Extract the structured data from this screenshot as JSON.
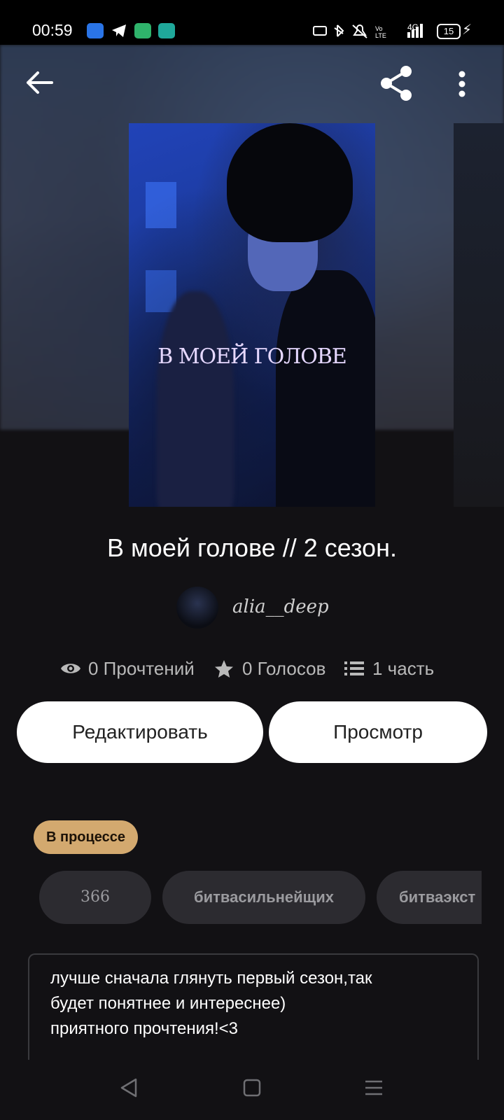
{
  "status_bar": {
    "time": "00:59",
    "network_label": "4G",
    "battery": "15"
  },
  "story": {
    "cover_title": "В МОЕЙ ГОЛОВЕ",
    "title": "В моей голове // 2 сезон.",
    "author": "alia__deep",
    "stats": {
      "reads": "0 Прочтений",
      "votes": "0 Голосов",
      "parts": "1 часть"
    },
    "status_badge": "В процессе",
    "tags": [
      "366",
      "битвасильнейщих",
      "битваэкст"
    ],
    "description": "лучше сначала глянуть первый сезон,так\nбудет понятнее и интереснее)\nприятного прочтения!<3"
  },
  "actions": {
    "edit_label": "Редактировать",
    "view_label": "Просмотр"
  },
  "colors": {
    "background": "#121114",
    "badge": "#d3a96f",
    "tag_bg": "#2c2b30",
    "button_bg": "#ffffff"
  },
  "icons": [
    "back-arrow-icon",
    "share-icon",
    "more-vertical-icon",
    "eye-icon",
    "star-icon",
    "list-icon",
    "nav-back-icon",
    "nav-home-icon",
    "nav-menu-icon"
  ]
}
